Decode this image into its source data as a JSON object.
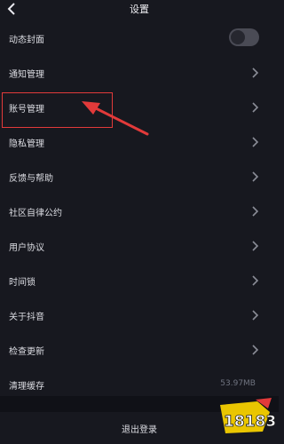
{
  "header": {
    "title": "设置",
    "back_icon": "chevron-left-icon"
  },
  "rows": [
    {
      "label": "动态封面",
      "control": "toggle",
      "toggle_on": false
    },
    {
      "label": "通知管理",
      "control": "chevron"
    },
    {
      "label": "账号管理",
      "control": "chevron",
      "highlighted": true
    },
    {
      "label": "隐私管理",
      "control": "chevron"
    },
    {
      "label": "反馈与帮助",
      "control": "chevron"
    },
    {
      "label": "社区自律公约",
      "control": "chevron"
    },
    {
      "label": "用户协议",
      "control": "chevron"
    },
    {
      "label": "时间锁",
      "control": "chevron"
    },
    {
      "label": "关于抖音",
      "control": "chevron"
    },
    {
      "label": "检查更新",
      "control": "chevron"
    },
    {
      "label": "清理缓存",
      "control": "value",
      "value": "53.97MB"
    }
  ],
  "footer": {
    "logout_label": "退出登录"
  },
  "annotation": {
    "highlight_color": "#e23a3a"
  },
  "watermark": {
    "text": "18183"
  },
  "colors": {
    "background": "#17181f",
    "text": "#dcdde3",
    "toggle_off": "#4a4b55"
  }
}
